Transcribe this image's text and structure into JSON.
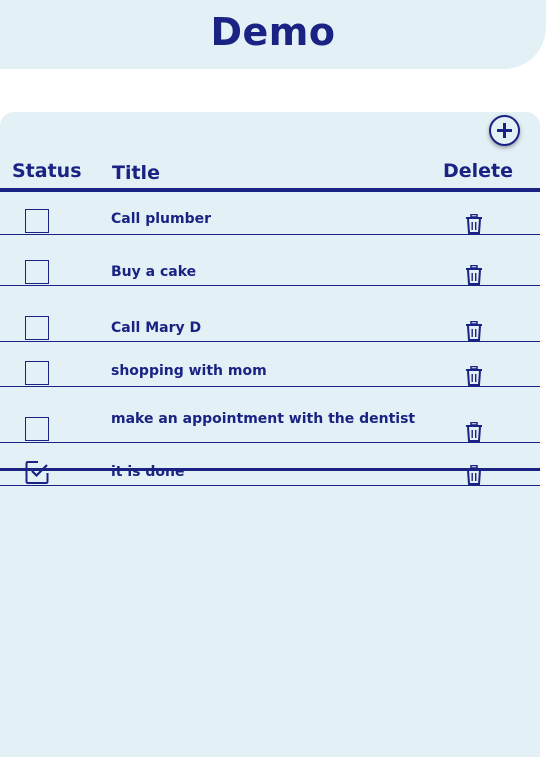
{
  "header": {
    "title": "Demo"
  },
  "toolbar": {
    "add_icon": "plus-circle-icon"
  },
  "columns": {
    "status": "Status",
    "title": "Title",
    "delete": "Delete"
  },
  "tasks": [
    {
      "title": "Call plumber",
      "done": false
    },
    {
      "title": "Buy a cake",
      "done": false
    },
    {
      "title": "Call Mary D",
      "done": false
    },
    {
      "title": "shopping with mom",
      "done": false
    },
    {
      "title": "make an appointment with the dentist",
      "done": false
    },
    {
      "title": " it is done",
      "done": true
    }
  ],
  "colors": {
    "accent": "#1a2384",
    "panel": "#e3f0f5",
    "background": "#ffffff"
  }
}
